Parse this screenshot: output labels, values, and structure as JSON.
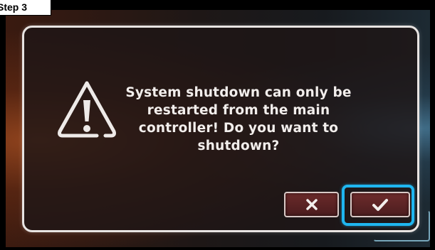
{
  "annotation": {
    "step_label": "Step 3",
    "highlight_color": "#1fb6f0"
  },
  "dialog": {
    "icon": "warning-triangle-icon",
    "message": "System shutdown can only be restarted from the main controller! Do you want to shutdown?",
    "buttons": {
      "cancel_icon": "close-x-icon",
      "confirm_icon": "checkmark-icon"
    }
  },
  "colors": {
    "border": "#e8e4e2",
    "button_fill": "#5a2326",
    "text": "#f2eeec"
  }
}
